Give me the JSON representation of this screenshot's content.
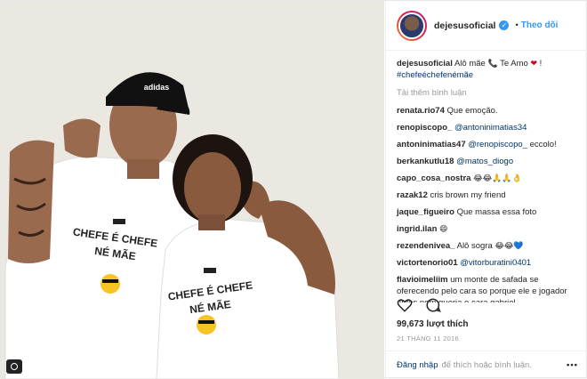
{
  "header": {
    "username": "dejesusoficial",
    "separator": "•",
    "follow_label": "Theo dõi"
  },
  "caption": {
    "username": "dejesusoficial",
    "text_1": "Alô mãe",
    "text_2": "Te Amo",
    "text_3": "!",
    "hashtag": "#chefeéchefenémãe"
  },
  "load_more": "Tải thêm bình luận",
  "comments": [
    {
      "user": "renata.rio74",
      "text": "Que emoção."
    },
    {
      "user": "renopiscopo_",
      "mention": "@antoninimatias34",
      "text": ""
    },
    {
      "user": "antoninimatias47",
      "mention": "@renopiscopo_",
      "text": " eccolo!"
    },
    {
      "user": "berkankutlu18",
      "mention": "@matos_diogo",
      "text": ""
    },
    {
      "user": "capo_cosa_nostra",
      "text": "",
      "emoji": "😂😂🙏🙏👌"
    },
    {
      "user": "razak12",
      "text": "cris brown my friend"
    },
    {
      "user": "jaque_figueiro",
      "text": "Que massa essa foto"
    },
    {
      "user": "ingrid.ilan",
      "text": "",
      "emoji": "😄"
    },
    {
      "user": "rezendenivea_",
      "text": "Alô sogra",
      "emoji": "😂😂💙"
    },
    {
      "user": "victortenorio01",
      "mention": "@vitorburatini0401",
      "text": ""
    },
    {
      "user": "flavioimeliim",
      "text": "um monte de safada se oferecendo pelo cara so porque ele e jogador antes nem queria o cara gabriel"
    }
  ],
  "likes": "99,673 lượt thích",
  "date": "21 THÁNG 11 2016",
  "footer": {
    "login": "Đăng nhập",
    "rest": "để thích hoặc bình luận.",
    "more": "•••"
  },
  "photo": {
    "shirt_text_left_1": "CHEFE É CHEFE",
    "shirt_text_left_2": "NÉ MÃE",
    "shirt_text_right_1": "CHEFE É CHEFE",
    "shirt_text_right_2": "NÉ MÃE",
    "cap_brand": "adidas",
    "colors": {
      "wall": "#efece6",
      "shirt": "#ffffff",
      "cap": "#111111",
      "skin_left": "#9a6a4f",
      "skin_right": "#8a5a3f",
      "accent_blue": "#3897f0"
    }
  }
}
